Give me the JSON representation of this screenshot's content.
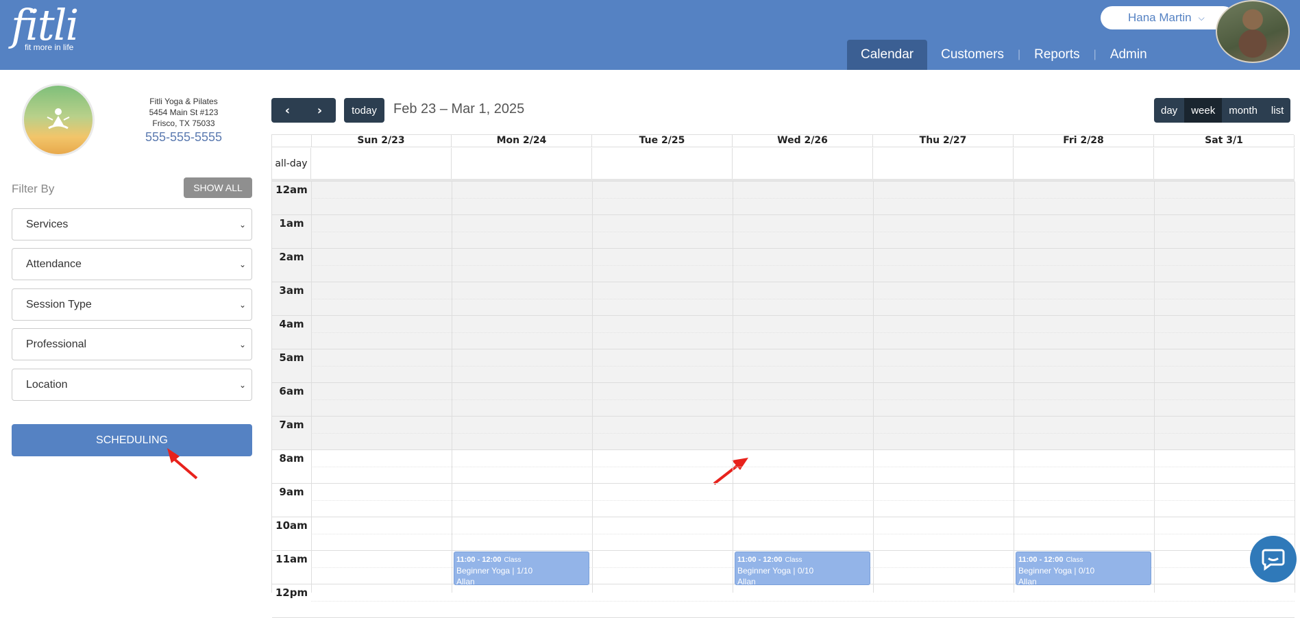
{
  "brand": {
    "name": "fitli",
    "tagline": "fit more in life"
  },
  "user": {
    "name": "Hana Martin"
  },
  "nav": {
    "items": [
      "Calendar",
      "Customers",
      "Reports",
      "Admin"
    ],
    "active": "Calendar"
  },
  "studio": {
    "name": "Fitli Yoga & Pilates",
    "address1": "5454 Main St #123",
    "address2": "Frisco, TX 75033",
    "phone": "555-555-5555"
  },
  "filters": {
    "label": "Filter By",
    "show_all": "SHOW ALL",
    "selects": [
      "Services",
      "Attendance",
      "Session Type",
      "Professional",
      "Location"
    ]
  },
  "scheduling_label": "SCHEDULING",
  "calendar": {
    "today_label": "today",
    "title": "Feb 23 – Mar 1, 2025",
    "views": [
      "day",
      "week",
      "month",
      "list"
    ],
    "active_view": "week",
    "allday_label": "all-day",
    "days": [
      "Sun 2/23",
      "Mon 2/24",
      "Tue 2/25",
      "Wed 2/26",
      "Thu 2/27",
      "Fri 2/28",
      "Sat 3/1"
    ],
    "hours": [
      "12am",
      "1am",
      "2am",
      "3am",
      "4am",
      "5am",
      "6am",
      "7am",
      "8am",
      "9am",
      "10am",
      "11am",
      "12pm"
    ],
    "events": [
      {
        "day": "Mon 2/24",
        "time": "11:00 - 12:00",
        "kind": "Class",
        "title": "Beginner Yoga | 1/10",
        "who": "Allan"
      },
      {
        "day": "Wed 2/26",
        "time": "11:00 - 12:00",
        "kind": "Class",
        "title": "Beginner Yoga | 0/10",
        "who": "Allan"
      },
      {
        "day": "Fri 2/28",
        "time": "11:00 - 12:00",
        "kind": "Class",
        "title": "Beginner Yoga | 0/10",
        "who": "Allan"
      }
    ]
  },
  "colors": {
    "header": "#5582c3",
    "dark": "#2c3e50",
    "event": "#93b4e8",
    "annotation": "#e8221c"
  },
  "icons": [
    "chevron-left-icon",
    "chevron-right-icon",
    "chevron-down-icon",
    "chat-icon",
    "meditation-icon"
  ]
}
